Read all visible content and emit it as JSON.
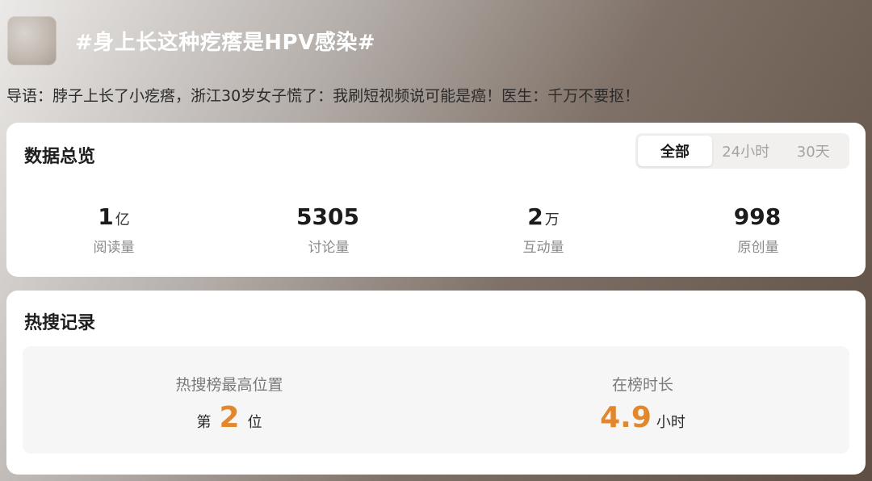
{
  "topic": {
    "title": "#身上长这种疙瘩是HPV感染#",
    "lead": "导语：脖子上长了小疙瘩，浙江30岁女子慌了：我刷短视频说可能是癌！医生：千万不要抠！"
  },
  "overview": {
    "title": "数据总览",
    "tabs": [
      {
        "label": "全部",
        "active": true
      },
      {
        "label": "24小时",
        "active": false
      },
      {
        "label": "30天",
        "active": false
      }
    ],
    "stats": [
      {
        "value": "1",
        "unit": "亿",
        "label": "阅读量"
      },
      {
        "value": "5305",
        "unit": "",
        "label": "讨论量"
      },
      {
        "value": "2",
        "unit": "万",
        "label": "互动量"
      },
      {
        "value": "998",
        "unit": "",
        "label": "原创量"
      }
    ]
  },
  "hot_record": {
    "title": "热搜记录",
    "peak": {
      "label": "热搜榜最高位置",
      "prefix": "第",
      "value": "2",
      "suffix": "位"
    },
    "duration": {
      "label": "在榜时长",
      "value": "4.9",
      "suffix": "小时"
    }
  },
  "colors": {
    "accent": "#e3872c"
  }
}
